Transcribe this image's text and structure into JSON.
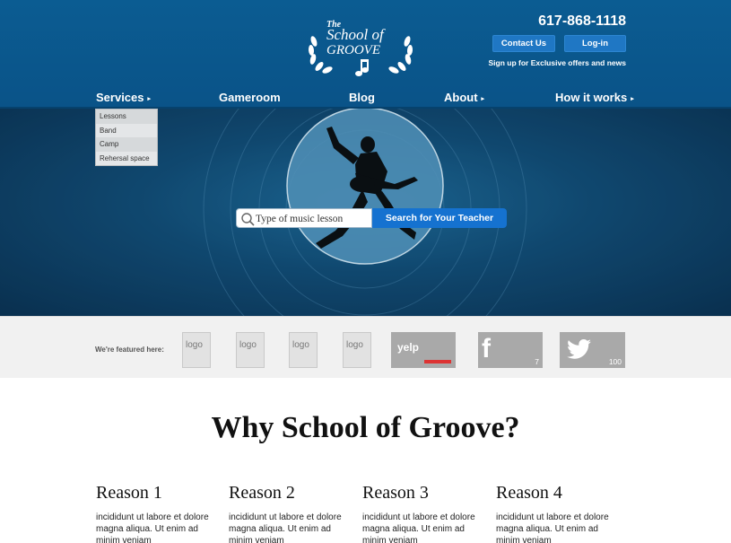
{
  "header": {
    "logo_text_top": "The",
    "logo_text_mid": "School of",
    "logo_text_bottom": "GROOVE",
    "phone": "617-868-1118",
    "contact_label": "Contact Us",
    "login_label": "Log-in",
    "signup_text": "Sign up for Exclusive offers and news"
  },
  "nav": {
    "services": "Services",
    "gameroom": "Gameroom",
    "blog": "Blog",
    "about": "About",
    "how": "How it works",
    "arrow": "▸"
  },
  "dropdown": {
    "items": [
      "Lessons",
      "Band",
      "Camp",
      "Rehersal space"
    ]
  },
  "hero": {
    "search_placeholder": "Type of music lesson",
    "search_button": "Search for Your Teacher"
  },
  "featured": {
    "label": "We're featured here:",
    "logo_label": "logo",
    "yelp": "yelp",
    "facebook_glyph": "f",
    "facebook_count": "7",
    "twitter_count": "100"
  },
  "why": {
    "title": "Why School of Groove?",
    "reasons": [
      {
        "title": "Reason 1",
        "text": "incididunt ut labore et dolore magna aliqua. Ut enim ad minim veniam"
      },
      {
        "title": "Reason 2",
        "text": "incididunt ut labore et dolore magna aliqua. Ut enim ad minim veniam"
      },
      {
        "title": "Reason 3",
        "text": "incididunt ut labore et dolore magna aliqua. Ut enim ad minim veniam"
      },
      {
        "title": "Reason 4",
        "text": "incididunt ut labore et dolore magna aliqua. Ut enim ad minim veniam"
      }
    ]
  },
  "colors": {
    "header_bg": "#0b5c92",
    "button_blue": "#1572d0",
    "featured_bg": "#f1f1f1"
  }
}
